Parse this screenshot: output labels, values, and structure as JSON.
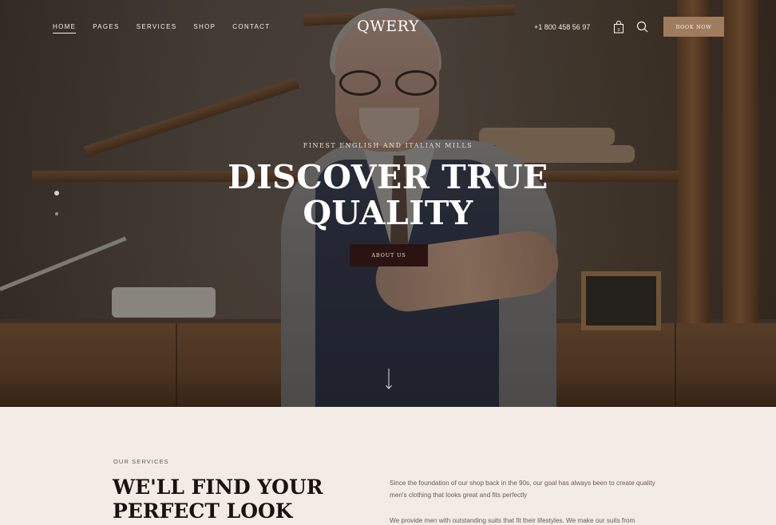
{
  "header": {
    "nav": [
      "HOME",
      "PAGES",
      "SERVICES",
      "SHOP",
      "CONTACT"
    ],
    "logo": "QWERY",
    "phone": "+1 800 458 56 97",
    "cart_count": "0",
    "book_label": "BOOK NOW"
  },
  "hero": {
    "eyebrow": "FINEST ENGLISH AND ITALIAN MILLS",
    "title": "DISCOVER TRUE QUALITY",
    "button_label": "ABOUT US"
  },
  "services": {
    "label": "OUR SERVICES",
    "title": "WE'LL FIND YOUR PERFECT LOOK",
    "paragraph_1": "Since the foundation of our shop back in the 90s, our goal has always been to create quality men's clothing that looks great and fits perfectly",
    "paragraph_2": "We provide men with outstanding suits that fit their lifestyles. We make our suits from"
  },
  "colors": {
    "accent": "#a07c5e",
    "dark_button": "#2a1310",
    "section_bg": "#f3ebe6"
  }
}
